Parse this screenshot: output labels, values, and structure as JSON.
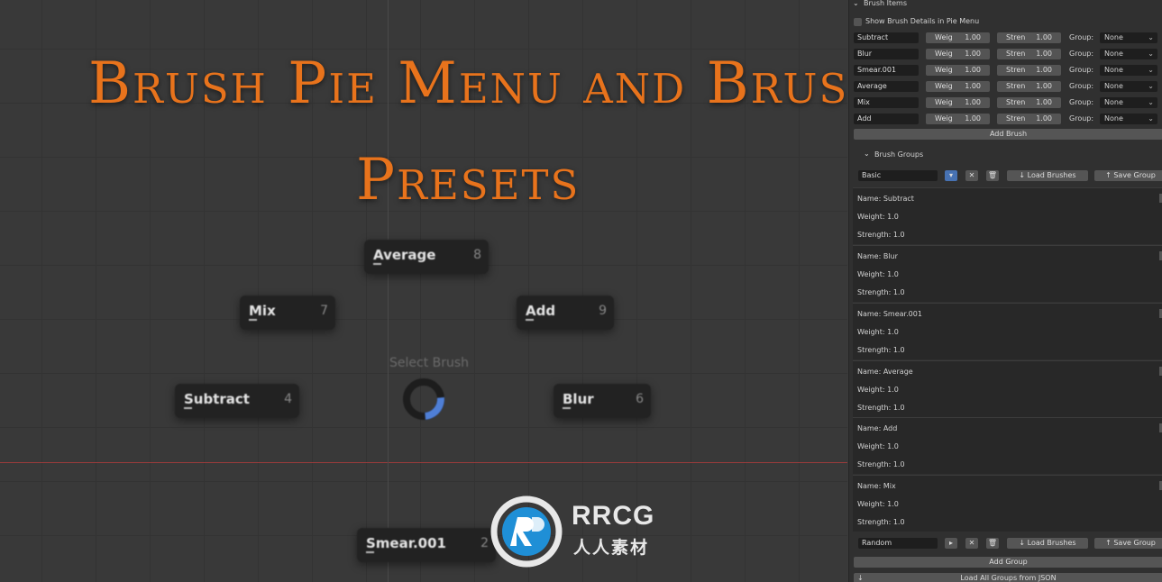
{
  "title": {
    "line1": "Brush Pie Menu and Brush Group",
    "line2": "Presets"
  },
  "pie_menu": {
    "center_label": "Select Brush",
    "items": [
      {
        "label": "Average",
        "key": "8"
      },
      {
        "label": "Mix",
        "key": "7"
      },
      {
        "label": "Add",
        "key": "9"
      },
      {
        "label": "Subtract",
        "key": "4"
      },
      {
        "label": "Blur",
        "key": "6"
      },
      {
        "label": "Smear.001",
        "key": "2"
      }
    ]
  },
  "watermark": {
    "text": "RRCG",
    "subtext": "人人素材"
  },
  "panel": {
    "brush_items_header": "Brush Items",
    "show_details_label": "Show Brush Details in Pie Menu",
    "weight_label": "Weig",
    "strength_label": "Stren",
    "group_label": "Group:",
    "brushes": [
      {
        "name": "Subtract",
        "weight": "1.00",
        "strength": "1.00",
        "group": "None"
      },
      {
        "name": "Blur",
        "weight": "1.00",
        "strength": "1.00",
        "group": "None"
      },
      {
        "name": "Smear.001",
        "weight": "1.00",
        "strength": "1.00",
        "group": "None"
      },
      {
        "name": "Average",
        "weight": "1.00",
        "strength": "1.00",
        "group": "None"
      },
      {
        "name": "Mix",
        "weight": "1.00",
        "strength": "1.00",
        "group": "None"
      },
      {
        "name": "Add",
        "weight": "1.00",
        "strength": "1.00",
        "group": "None"
      }
    ],
    "add_brush": "Add Brush",
    "brush_groups_header": "Brush Groups",
    "group1": {
      "name": "Basic",
      "load": "Load Brushes",
      "save": "Save Group"
    },
    "group_entries": [
      {
        "name": "Name: Subtract",
        "weight": "Weight: 1.0",
        "strength": "Strength: 1.0"
      },
      {
        "name": "Name: Blur",
        "weight": "Weight: 1.0",
        "strength": "Strength: 1.0"
      },
      {
        "name": "Name: Smear.001",
        "weight": "Weight: 1.0",
        "strength": "Strength: 1.0"
      },
      {
        "name": "Name: Average",
        "weight": "Weight: 1.0",
        "strength": "Strength: 1.0"
      },
      {
        "name": "Name: Add",
        "weight": "Weight: 1.0",
        "strength": "Strength: 1.0"
      },
      {
        "name": "Name: Mix",
        "weight": "Weight: 1.0",
        "strength": "Strength: 1.0"
      }
    ],
    "group2": {
      "name": "Random",
      "load": "Load Brushes",
      "save": "Save Group"
    },
    "add_group": "Add Group",
    "load_all": "Load All Groups from JSON"
  }
}
